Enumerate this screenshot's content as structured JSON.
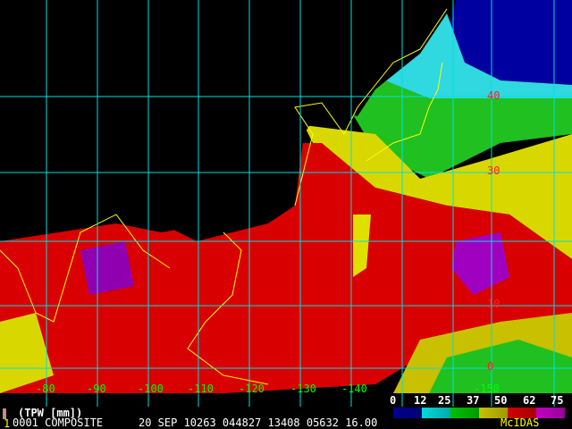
{
  "product": {
    "title": "(TPW [mm])",
    "frame_number": "1",
    "frame_info": "0001 COMPOSITE",
    "date_time": "20 SEP 10263 044827 13408 05632 16.00",
    "brand": "McIDAS"
  },
  "map": {
    "longitude_labels": [
      "-80",
      "-90",
      "-100",
      "-110",
      "-120",
      "-130",
      "-140",
      "-150"
    ],
    "latitude_labels": [
      "40",
      "30",
      "10",
      "0"
    ],
    "grid_color": "#00e0e0",
    "coast_color": "#ffff00"
  },
  "legend": {
    "ticks": [
      "0",
      "12",
      "25",
      "37",
      "50",
      "62",
      "75"
    ],
    "colors": [
      "#000090",
      "#00d8d8",
      "#00c000",
      "#c8c000",
      "#d00000",
      "#c000c0"
    ]
  }
}
